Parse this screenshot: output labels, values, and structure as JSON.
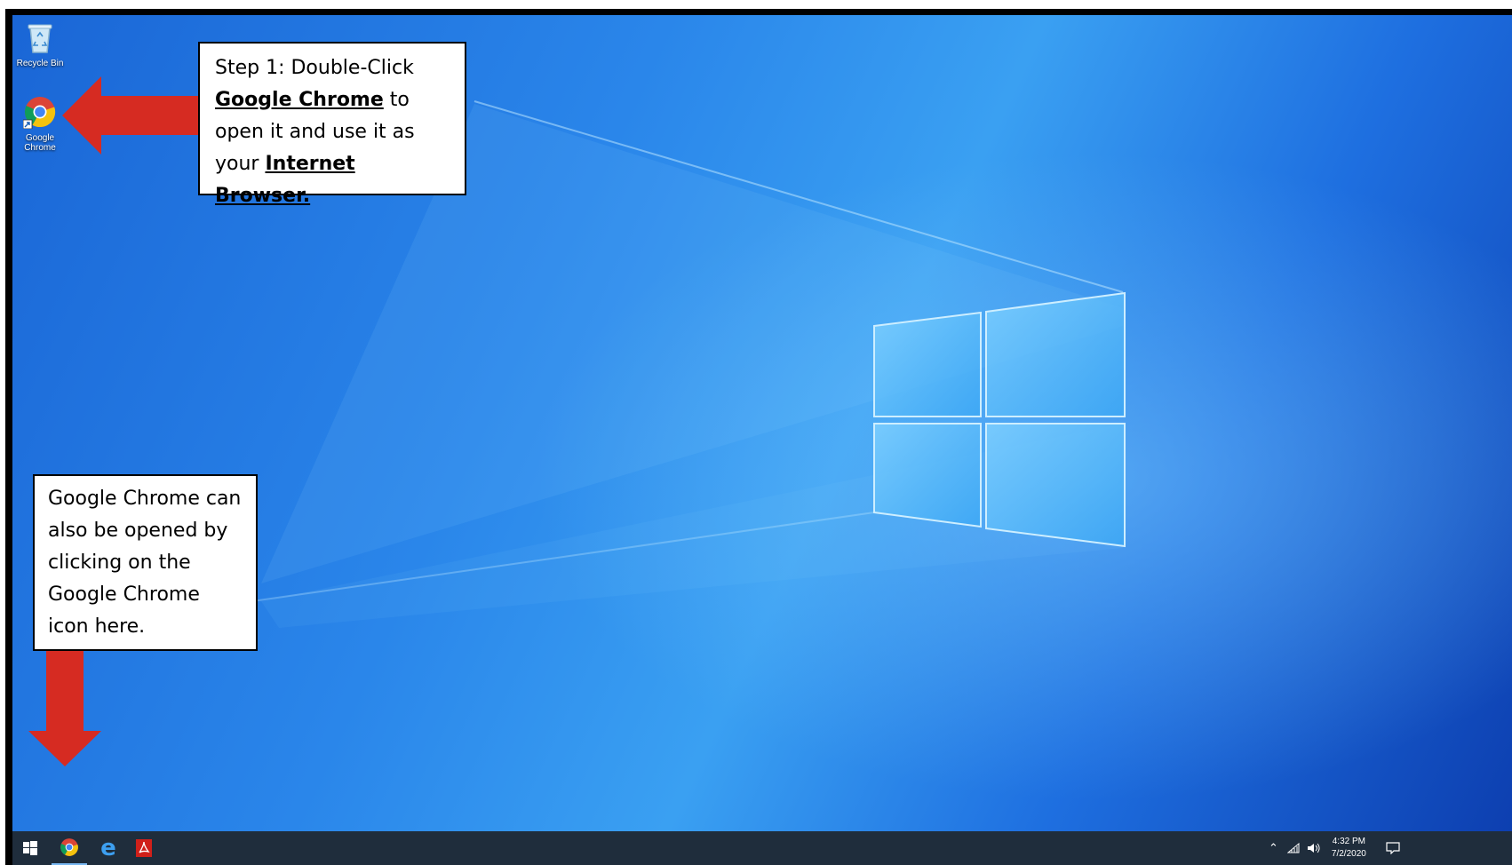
{
  "desktop": {
    "icons": [
      {
        "name": "recycle-bin",
        "label": "Recycle Bin"
      },
      {
        "name": "google-chrome",
        "label": "Google Chrome"
      }
    ]
  },
  "callout_top": {
    "line1": "Step 1: Double-Click",
    "bold1": "Google Chrome",
    "after_bold1": " to",
    "line3": "open it and use it as",
    "line4_prefix": "your ",
    "bold2": "Internet Browser."
  },
  "callout_bottom": {
    "text": "Google Chrome can also be opened by clicking on the Google Chrome icon here."
  },
  "taskbar": {
    "items": [
      "start-button",
      "chrome-taskbar-icon",
      "edge-taskbar-icon",
      "acrobat-taskbar-icon"
    ],
    "clock_time": "4:32 PM",
    "clock_date": "7/2/2020"
  },
  "colors": {
    "arrow": "#d62b22",
    "taskbar": "#1f2d3c",
    "desktop_blue": "#2a86ea"
  }
}
